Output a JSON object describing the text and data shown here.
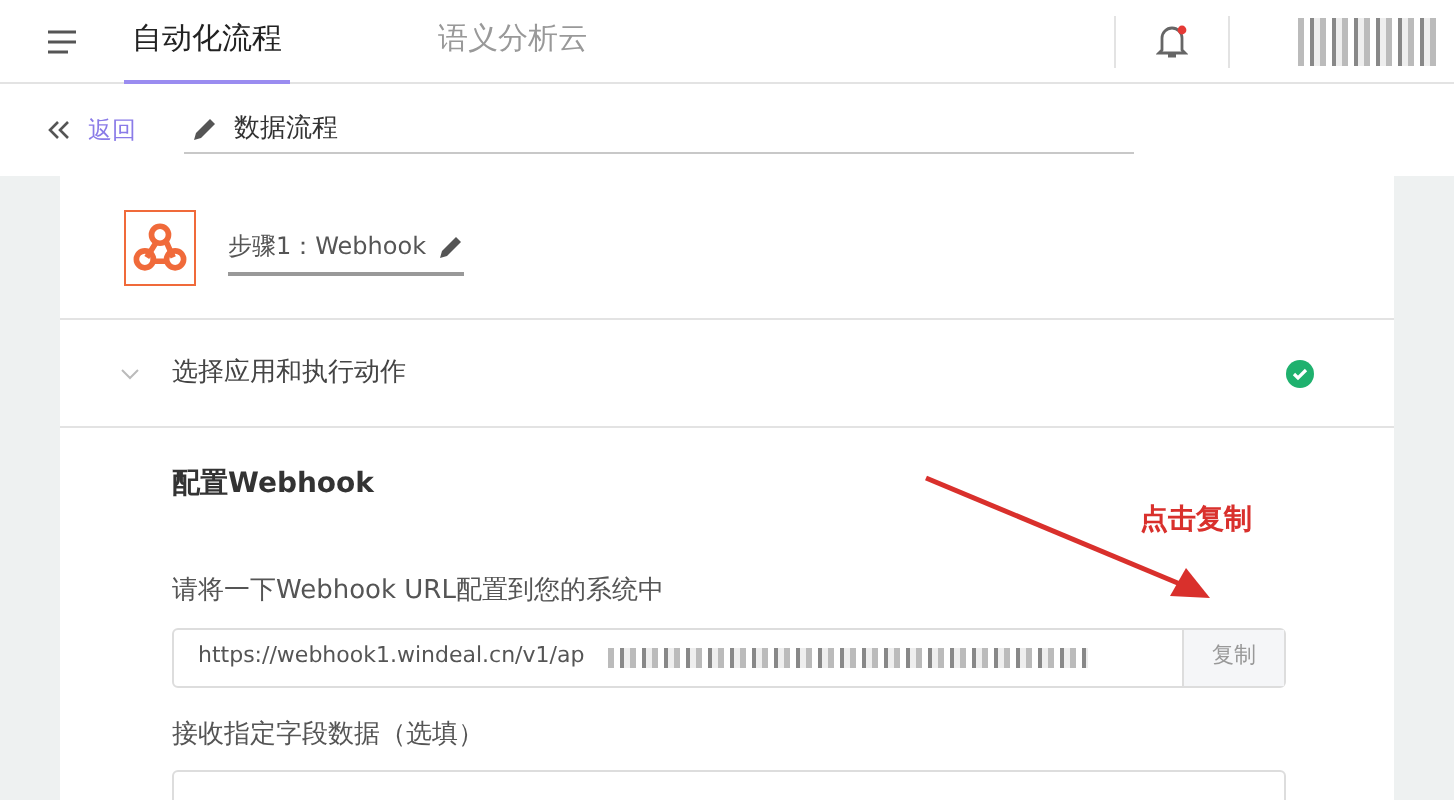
{
  "header": {
    "tabs": [
      {
        "label": "自动化流程",
        "selected": true
      },
      {
        "label": "语义分析云",
        "selected": false
      }
    ],
    "notification": {
      "unread": true
    }
  },
  "subbar": {
    "back": "返回",
    "flow_name": "数据流程"
  },
  "step": {
    "title": "步骤1：Webhook"
  },
  "action_row": {
    "label": "选择应用和执行动作",
    "expanded": false,
    "done": true
  },
  "config": {
    "title": "配置Webhook",
    "url_label": "请将一下Webhook URL配置到您的系统中",
    "url_value": "https://webhook1.windeal.cn/v1/ap",
    "copy_button": "复制",
    "fields_label": "接收指定字段数据（选填）"
  },
  "annotation": {
    "text": "点击复制"
  }
}
